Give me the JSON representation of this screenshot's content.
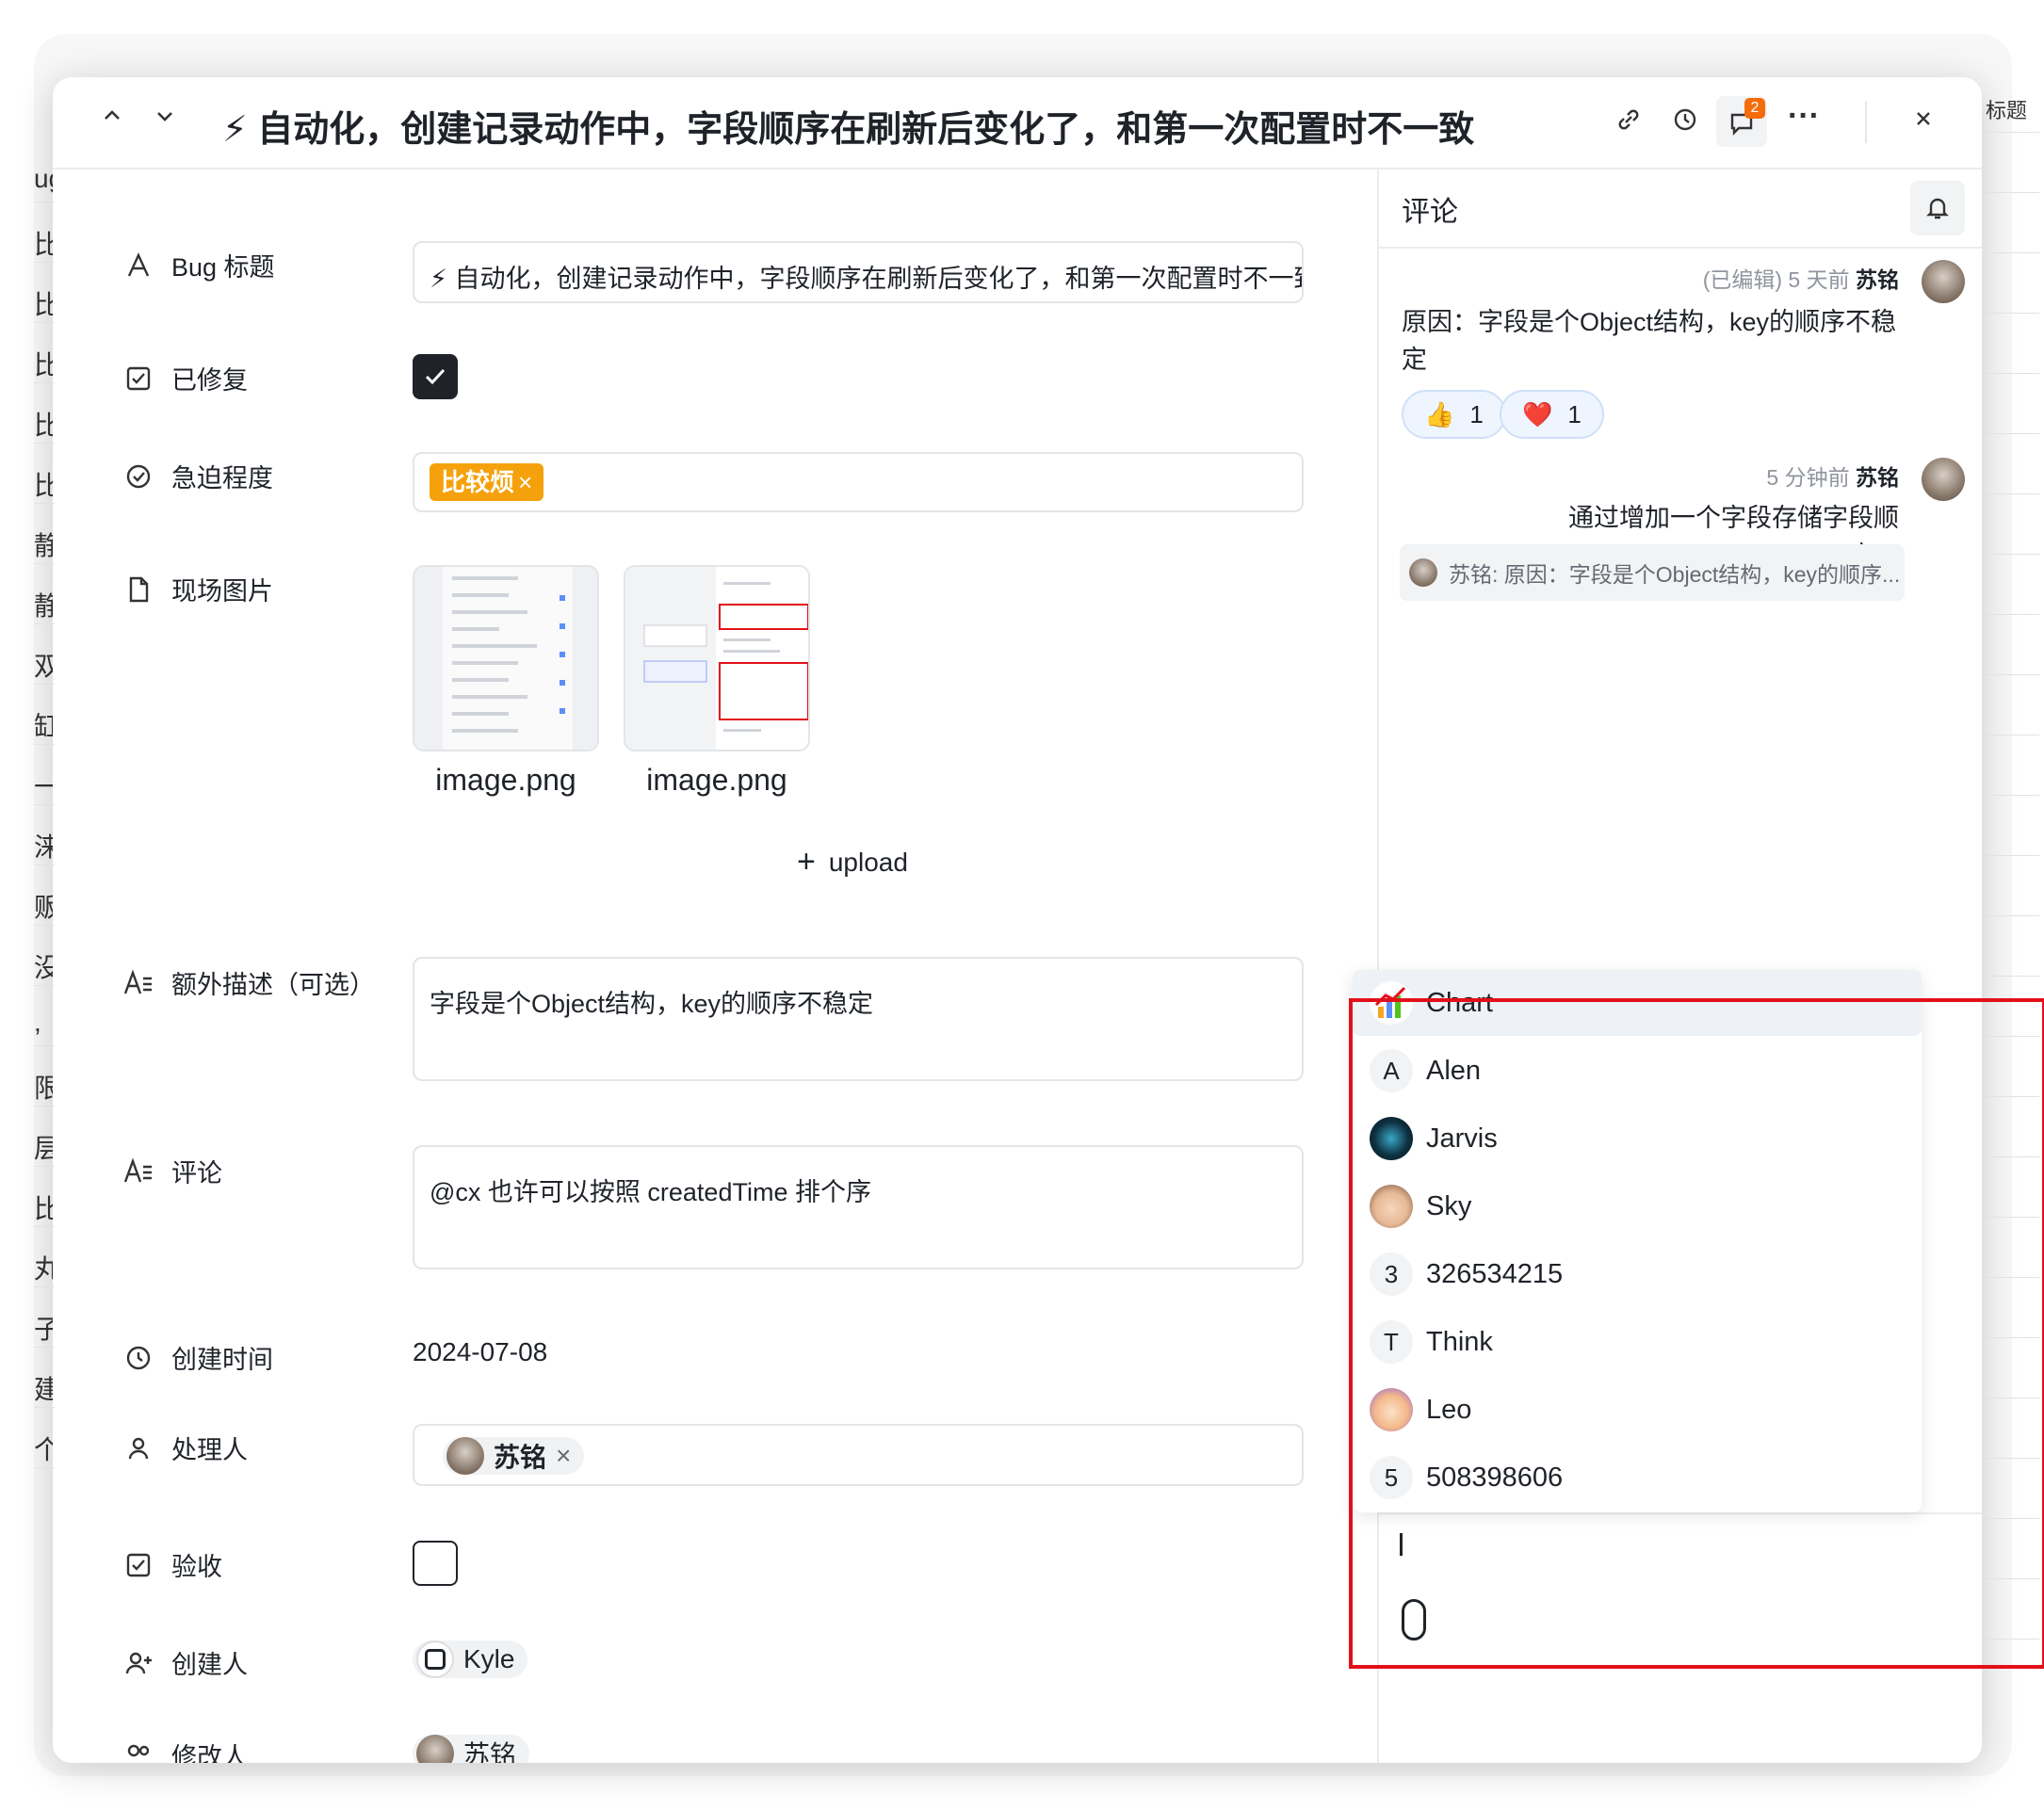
{
  "background": {
    "left_fragments": [
      "ug",
      "比",
      "比,",
      "比,",
      "比,",
      "比",
      "静",
      "静",
      "双",
      "缸",
      "一",
      "涞",
      "贩",
      "没",
      ",",
      "限",
      "层",
      "比,",
      "丸",
      "子",
      "建",
      "个"
    ],
    "right_fragment": "标题"
  },
  "header": {
    "title": "⚡ 自动化，创建记录动作中，字段顺序在刷新后变化了，和第一次配置时不一致",
    "comment_badge": "2",
    "icons": [
      "chevron-up-icon",
      "chevron-down-icon",
      "link-icon",
      "history-icon",
      "comment-icon",
      "more-icon",
      "close-icon"
    ]
  },
  "form": {
    "bug_title": {
      "label": "Bug 标题",
      "value": "⚡ 自动化，创建记录动作中，字段顺序在刷新后变化了，和第一次配置时不一致"
    },
    "fixed": {
      "label": "已修复",
      "checked": true
    },
    "urgency": {
      "label": "急迫程度",
      "tag": "比较烦"
    },
    "images": {
      "label": "现场图片",
      "files": [
        "image.png",
        "image.png"
      ],
      "upload_label": "upload"
    },
    "extra_desc": {
      "label": "额外描述（可选）",
      "value": "字段是个Object结构，key的顺序不稳定"
    },
    "comment": {
      "label": "评论",
      "value": "@cx 也许可以按照 createdTime 排个序"
    },
    "created_time": {
      "label": "创建时间",
      "value": "2024-07-08"
    },
    "assignee": {
      "label": "处理人",
      "value": "苏铭"
    },
    "accepted": {
      "label": "验收",
      "checked": false
    },
    "creator": {
      "label": "创建人",
      "value": "Kyle"
    },
    "modifier": {
      "label": "修改人",
      "value": "苏铭"
    }
  },
  "comments": {
    "title": "评论",
    "items": [
      {
        "edited": "(已编辑)",
        "time": "5 天前",
        "author": "苏铭",
        "text": "原因：字段是个Object结构，key的顺序不稳定",
        "reactions": [
          {
            "emoji": "👍",
            "count": "1"
          },
          {
            "emoji": "❤️",
            "count": "1"
          }
        ]
      },
      {
        "time": "5 分钟前",
        "author": "苏铭",
        "text": "通过增加一个字段存储字段顺序。",
        "quote": "苏铭: 原因：字段是个Object结构，key的顺序..."
      }
    ]
  },
  "mention_list": [
    {
      "name": "Chart",
      "avatar": "📈",
      "active": true
    },
    {
      "name": "Alen",
      "avatar": "A"
    },
    {
      "name": "Jarvis",
      "avatar": ""
    },
    {
      "name": "Sky",
      "avatar": ""
    },
    {
      "name": "326534215",
      "avatar": "3"
    },
    {
      "name": "Think",
      "avatar": "T"
    },
    {
      "name": "Leo",
      "avatar": ""
    },
    {
      "name": "508398606",
      "avatar": "5"
    }
  ],
  "colors": {
    "accent_orange": "#f5a10b",
    "highlight_red": "#e3101a",
    "badge_orange": "#f56c0b"
  }
}
